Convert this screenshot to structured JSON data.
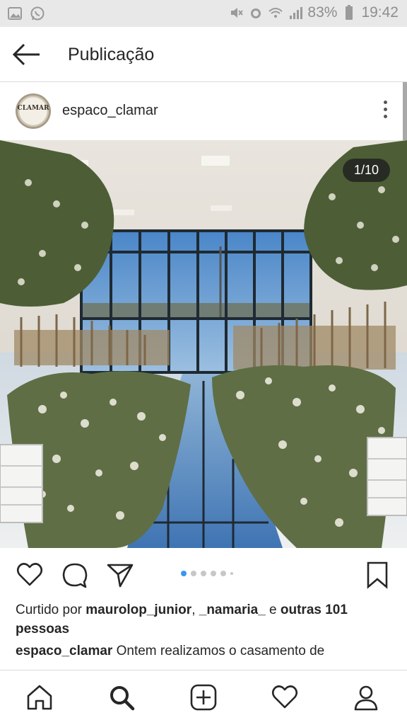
{
  "status_bar": {
    "battery": "83%",
    "time": "19:42",
    "icons": [
      "gallery-icon",
      "whatsapp-icon",
      "mute-icon",
      "alarm-icon",
      "wifi-icon",
      "signal-icon",
      "battery-icon"
    ]
  },
  "header": {
    "title": "Publicação",
    "back_icon": "arrow-left-icon"
  },
  "post": {
    "username": "espaco_clamar",
    "avatar_text": "CLAMAR",
    "counter": "1/10",
    "carousel": {
      "total_dots": 6,
      "active_index": 0
    }
  },
  "likes": {
    "prefix": "Curtido por ",
    "user1": "maurolop_junior",
    "sep": ", ",
    "user2": "_namaria_",
    "middle": " e ",
    "others": "outras 101 pessoas"
  },
  "caption": {
    "username": "espaco_clamar",
    "text": " Ontem realizamos o casamento de"
  },
  "nav": {
    "items": [
      "home-icon",
      "search-icon",
      "add-icon",
      "heart-icon",
      "profile-icon"
    ]
  },
  "colors": {
    "accent_dot": "#3897f0",
    "text": "#262626",
    "divider": "#dbdbdb"
  }
}
